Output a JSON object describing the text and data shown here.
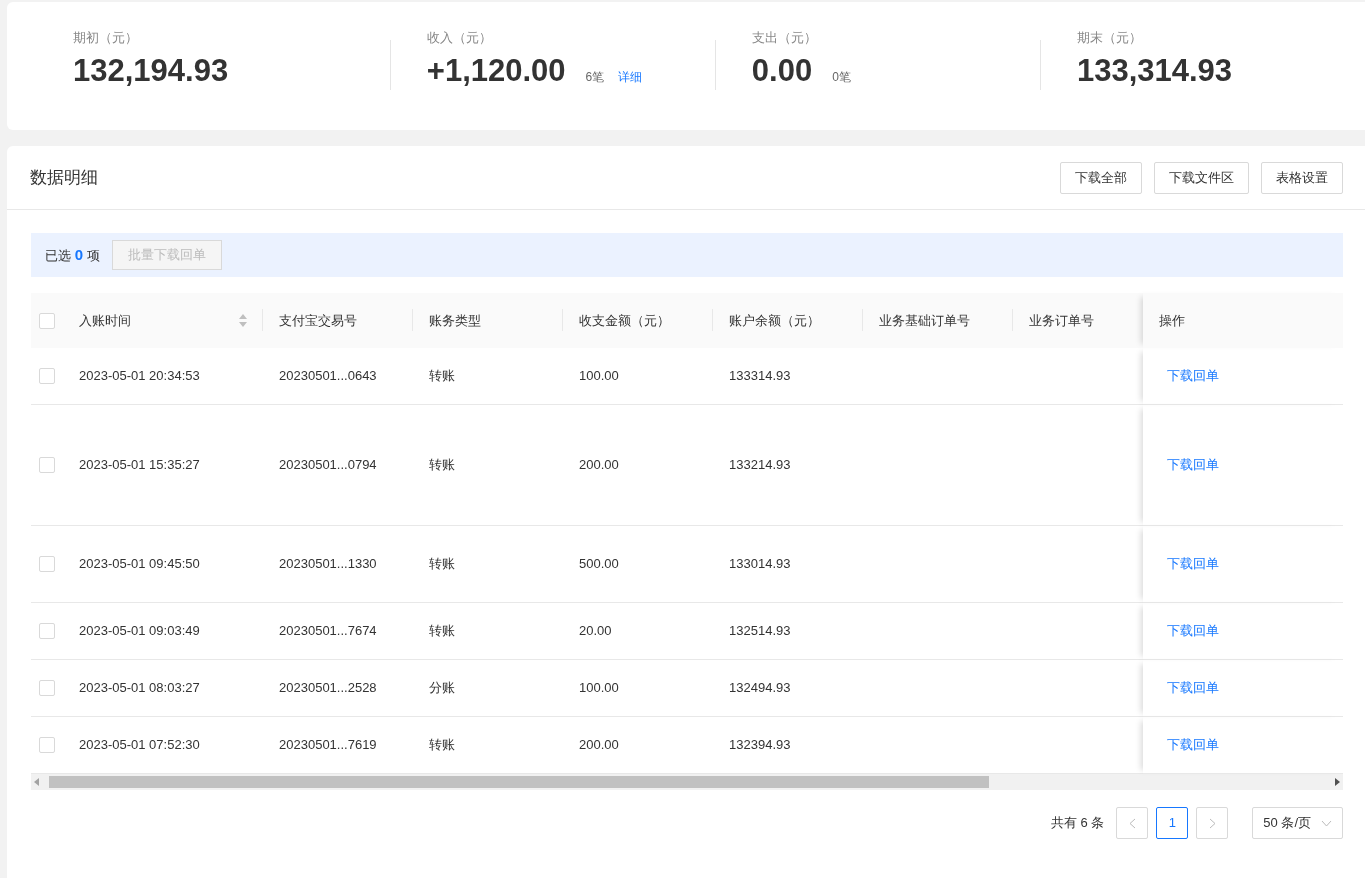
{
  "summary": [
    {
      "label": "期初（元）",
      "value": "132,194.93"
    },
    {
      "label": "收入（元）",
      "value": "+1,120.00",
      "count": "6笔",
      "link": "详细"
    },
    {
      "label": "支出（元）",
      "value": "0.00",
      "count": "0笔"
    },
    {
      "label": "期末（元）",
      "value": "133,314.93"
    }
  ],
  "panel": {
    "title": "数据明细",
    "buttons": [
      "下载全部",
      "下载文件区",
      "表格设置"
    ]
  },
  "selection_bar": {
    "text": "已选 **0** 项",
    "button": {
      "label": "批量下载回单",
      "disabled": true
    }
  },
  "table": {
    "select_all": {
      "checked": false
    },
    "columns": [
      {
        "label": "入账时间",
        "sortable": true
      },
      {
        "label": "支付宝交易号",
        "sortable": false
      },
      {
        "label": "账务类型",
        "sortable": false
      },
      {
        "label": "收支金额（元）",
        "sortable": false
      },
      {
        "label": "账户余额（元）",
        "sortable": false
      },
      {
        "label": "业务基础订单号",
        "sortable": false
      },
      {
        "label": "业务订单号",
        "sortable": false
      },
      {
        "label": "操作",
        "sortable": false
      }
    ],
    "rows": [
      {
        "checked": false,
        "cells": [
          "2023-05-01 20:34:53",
          "20230501...0643",
          "转账",
          "100.00",
          "133314.93",
          "",
          ""
        ],
        "action": "下载回单"
      },
      {
        "checked": false,
        "cells": [
          "2023-05-01 15:35:27",
          "20230501...0794",
          "转账",
          "200.00",
          "133214.93",
          "",
          ""
        ],
        "action": "下载回单"
      },
      {
        "checked": false,
        "cells": [
          "2023-05-01 09:45:50",
          "20230501...1330",
          "转账",
          "500.00",
          "133014.93",
          "",
          ""
        ],
        "action": "下载回单"
      },
      {
        "checked": false,
        "cells": [
          "2023-05-01 09:03:49",
          "20230501...7674",
          "转账",
          "20.00",
          "132514.93",
          "",
          ""
        ],
        "action": "下载回单"
      },
      {
        "checked": false,
        "cells": [
          "2023-05-01 08:03:27",
          "20230501...2528",
          "分账",
          "100.00",
          "132494.93",
          "",
          ""
        ],
        "action": "下载回单"
      },
      {
        "checked": false,
        "cells": [
          "2023-05-01 07:52:30",
          "20230501...7619",
          "转账",
          "200.00",
          "132394.93",
          "",
          ""
        ],
        "action": "下载回单"
      }
    ]
  },
  "pagination": {
    "total": "共有 6 条",
    "pages": [
      {
        "label": "1",
        "selected": true
      }
    ],
    "page_size": "50 条/页"
  }
}
